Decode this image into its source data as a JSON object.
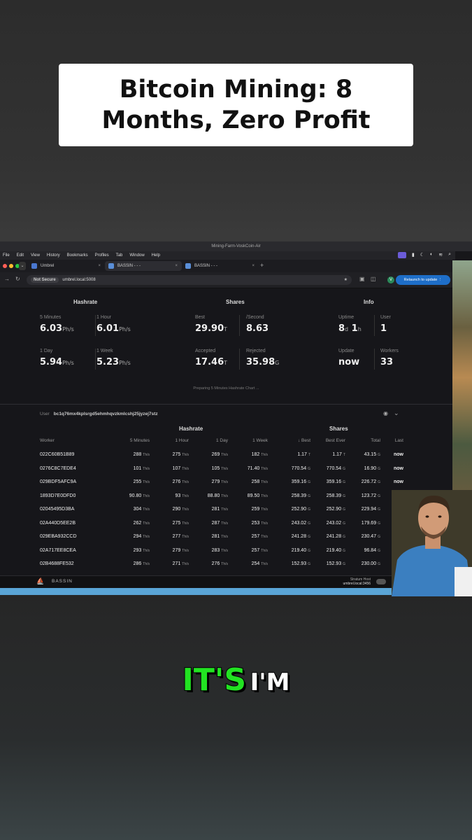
{
  "overlay": {
    "title": "Bitcoin Mining: 8 Months, Zero Profit",
    "caption_word1": "IT'S",
    "caption_word2": "I'M"
  },
  "window": {
    "title": "Mining-Farm-VoskCoin-Air",
    "menu": [
      "File",
      "Edit",
      "View",
      "History",
      "Bookmarks",
      "Profiles",
      "Tab",
      "Window",
      "Help"
    ],
    "tabs": [
      {
        "label": "Umbrel"
      },
      {
        "label": "BASSIN - - -"
      },
      {
        "label": "BASSIN - - -"
      }
    ],
    "not_secure": "Not Secure",
    "url": "umbrel.local:5008",
    "relaunch": "Relaunch to update",
    "avatar_letter": "V"
  },
  "summary": {
    "hashrate_title": "Hashrate",
    "shares_title": "Shares",
    "info_title": "Info",
    "stats": [
      {
        "label": "5 Minutes",
        "value": "6.03",
        "unit": "Ph/s"
      },
      {
        "label": "1 Hour",
        "value": "6.01",
        "unit": "Ph/s"
      },
      {
        "label": "1 Day",
        "value": "5.94",
        "unit": "Ph/s"
      },
      {
        "label": "1 Week",
        "value": "5.23",
        "unit": "Ph/s"
      },
      {
        "label": "Best",
        "value": "29.90",
        "unit": "T"
      },
      {
        "label": "/Second",
        "value": "8.63",
        "unit": ""
      },
      {
        "label": "Accepted",
        "value": "17.46",
        "unit": "T"
      },
      {
        "label": "Rejected",
        "value": "35.98",
        "unit": "G"
      },
      {
        "label": "Uptime",
        "value": "8",
        "unit": "d",
        "value2": "1",
        "unit2": "h"
      },
      {
        "label": "User",
        "value": "1",
        "unit": ""
      },
      {
        "label": "Update",
        "value": "now",
        "unit": ""
      },
      {
        "label": "Workers",
        "value": "33",
        "unit": ""
      }
    ],
    "preparing": "Preparing 5 Minutes Hashrate Chart ..."
  },
  "user": {
    "label": "User",
    "address": "bc1q76mx4kplsrgd5ehmhqvzkmlcshj25jyzej7stz"
  },
  "table": {
    "group_hashrate": "Hashrate",
    "group_shares": "Shares",
    "headers": [
      "Worker",
      "5 Minutes",
      "1 Hour",
      "1 Day",
      "1 Week",
      "↓ Best",
      "Best Ever",
      "Total",
      "Last"
    ],
    "rows": [
      [
        "022C60B51B89",
        "288",
        "Th/s",
        "275",
        "Th/s",
        "269",
        "Th/s",
        "182",
        "Th/s",
        "1.17",
        "T",
        "1.17",
        "T",
        "43.15",
        "G",
        "now"
      ],
      [
        "0276C8C7EDE4",
        "101",
        "Th/s",
        "107",
        "Th/s",
        "105",
        "Th/s",
        "71.40",
        "Th/s",
        "770.54",
        "G",
        "770.54",
        "G",
        "16.90",
        "G",
        "now"
      ],
      [
        "029BDF5AFC9A",
        "255",
        "Th/s",
        "276",
        "Th/s",
        "279",
        "Th/s",
        "258",
        "Th/s",
        "359.16",
        "G",
        "359.16",
        "G",
        "226.72",
        "G",
        "now"
      ],
      [
        "1893D7E0DFD0",
        "90.80",
        "Th/s",
        "93",
        "Th/s",
        "88.80",
        "Th/s",
        "89.50",
        "Th/s",
        "258.39",
        "G",
        "258.39",
        "G",
        "123.72",
        "G",
        "now"
      ],
      [
        "02045495D3BA",
        "304",
        "Th/s",
        "290",
        "Th/s",
        "281",
        "Th/s",
        "259",
        "Th/s",
        "252.90",
        "G",
        "252.90",
        "G",
        "229.94",
        "G",
        "now"
      ],
      [
        "02A440D5EE2B",
        "262",
        "Th/s",
        "275",
        "Th/s",
        "287",
        "Th/s",
        "253",
        "Th/s",
        "243.02",
        "G",
        "243.02",
        "G",
        "179.69",
        "G",
        "now"
      ],
      [
        "029EBA932CCD",
        "294",
        "Th/s",
        "277",
        "Th/s",
        "281",
        "Th/s",
        "257",
        "Th/s",
        "241.28",
        "G",
        "241.28",
        "G",
        "230.47",
        "G",
        "now"
      ],
      [
        "02A717EE8CEA",
        "293",
        "Th/s",
        "279",
        "Th/s",
        "283",
        "Th/s",
        "257",
        "Th/s",
        "219.40",
        "G",
        "219.40",
        "G",
        "96.84",
        "G",
        "now"
      ],
      [
        "02B4688FE532",
        "286",
        "Th/s",
        "271",
        "Th/s",
        "276",
        "Th/s",
        "254",
        "Th/s",
        "152.93",
        "G",
        "152.93",
        "G",
        "230.00",
        "G",
        "now"
      ]
    ]
  },
  "footer": {
    "brand": "BASSIN",
    "stratum_label": "Stratum Host",
    "stratum_host": "umbrel.local:3456"
  }
}
